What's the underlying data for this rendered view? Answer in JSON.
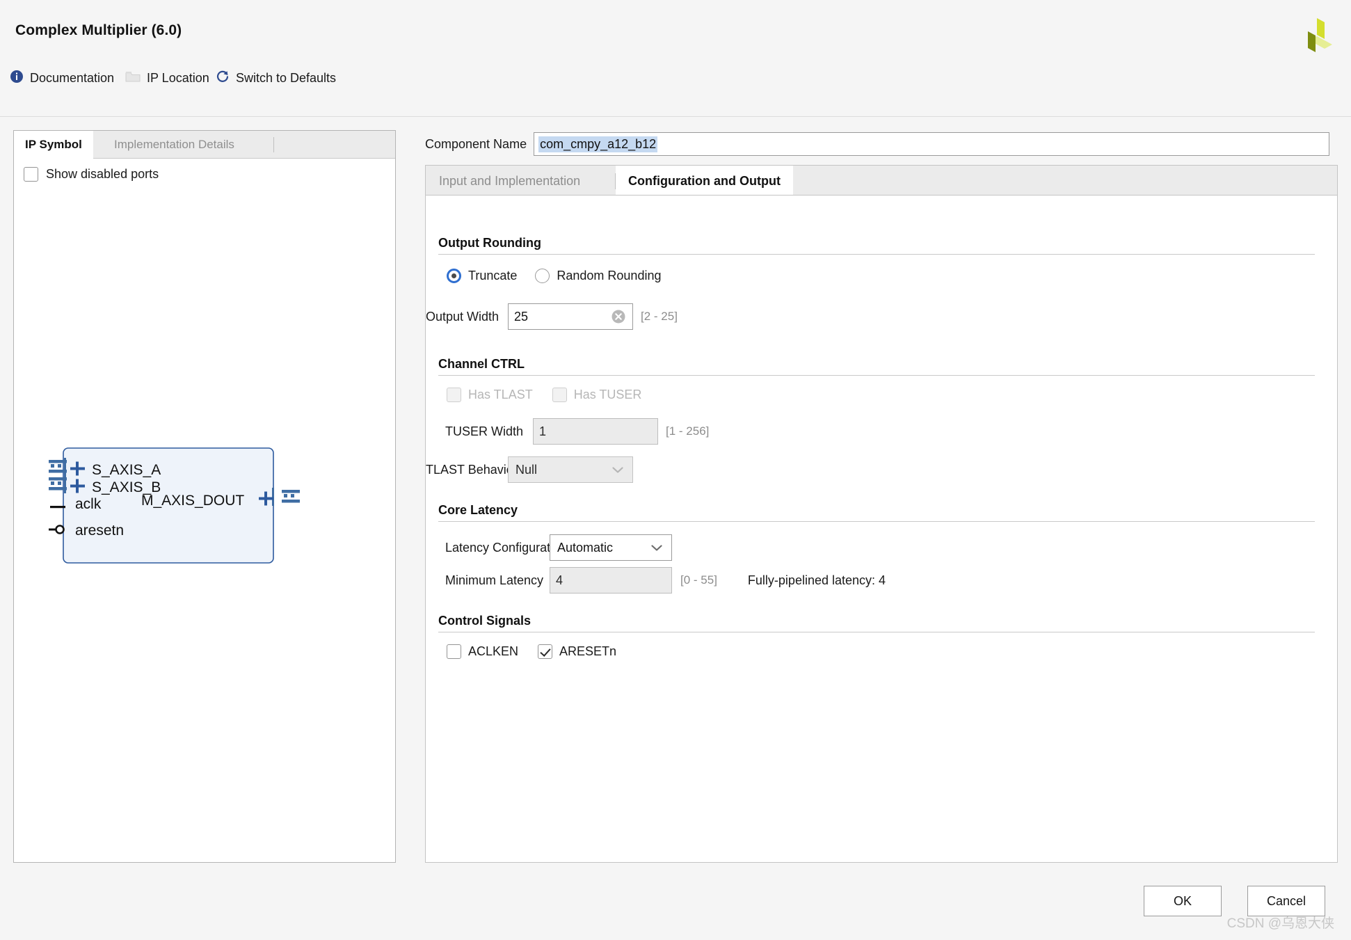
{
  "window": {
    "title": "Complex Multiplier (6.0)",
    "logo_colors": [
      "#c9d62b",
      "#e8ef8e",
      "#7d8c12"
    ]
  },
  "toolbar": {
    "items": [
      {
        "label": "Documentation",
        "icon": "info-icon",
        "enabled": true
      },
      {
        "label": "IP Location",
        "icon": "folder-icon",
        "enabled": false
      },
      {
        "label": "Switch to Defaults",
        "icon": "refresh-icon",
        "enabled": true
      }
    ]
  },
  "left_panel": {
    "tabs": [
      {
        "label": "IP Symbol",
        "active": true
      },
      {
        "label": "Implementation Details",
        "active": false
      }
    ],
    "show_disabled_ports": {
      "label": "Show disabled ports",
      "checked": false
    },
    "symbol": {
      "left_ports": [
        {
          "name": "S_AXIS_A",
          "type": "bus",
          "expandable": true
        },
        {
          "name": "S_AXIS_B",
          "type": "bus",
          "expandable": true
        },
        {
          "name": "aclk",
          "type": "clock",
          "expandable": false
        },
        {
          "name": "aresetn",
          "type": "reset-active-low",
          "expandable": false
        }
      ],
      "right_ports": [
        {
          "name": "M_AXIS_DOUT",
          "type": "bus",
          "expandable": true
        }
      ]
    }
  },
  "right_panel": {
    "component_name": {
      "label": "Component Name",
      "value": "com_cmpy_a12_b12"
    },
    "tabs": [
      {
        "label": "Input and Implementation",
        "active": false
      },
      {
        "label": "Configuration and Output",
        "active": true
      }
    ],
    "groups": {
      "output_rounding": {
        "title": "Output Rounding",
        "rounding_mode": {
          "options": [
            "Truncate",
            "Random Rounding"
          ],
          "selected": "Truncate"
        },
        "output_width": {
          "label": "Output Width",
          "value": "25",
          "range": "[2 - 25]",
          "clear_icon": "clear-circle-icon"
        }
      },
      "channel_ctrl": {
        "title": "Channel CTRL",
        "has_tlast": {
          "label": "Has TLAST",
          "checked": false,
          "enabled": false
        },
        "has_tuser": {
          "label": "Has TUSER",
          "checked": false,
          "enabled": false
        },
        "tuser_width": {
          "label": "TUSER Width",
          "value": "1",
          "range": "[1 - 256]",
          "enabled": false
        },
        "tlast_behavior": {
          "label": "TLAST Behavior",
          "value": "Null",
          "enabled": false
        }
      },
      "core_latency": {
        "title": "Core Latency",
        "latency_configuration": {
          "label": "Latency Configuration",
          "value": "Automatic",
          "enabled": true
        },
        "minimum_latency": {
          "label": "Minimum Latency",
          "value": "4",
          "range": "[0 - 55]",
          "enabled": false
        },
        "fully_pipelined_note": "Fully-pipelined latency: 4"
      },
      "control_signals": {
        "title": "Control Signals",
        "aclken": {
          "label": "ACLKEN",
          "checked": false
        },
        "aresetn": {
          "label": "ARESETn",
          "checked": true
        }
      }
    }
  },
  "footer": {
    "ok_label": "OK",
    "cancel_label": "Cancel"
  },
  "watermark": "CSDN @乌恩大侠"
}
